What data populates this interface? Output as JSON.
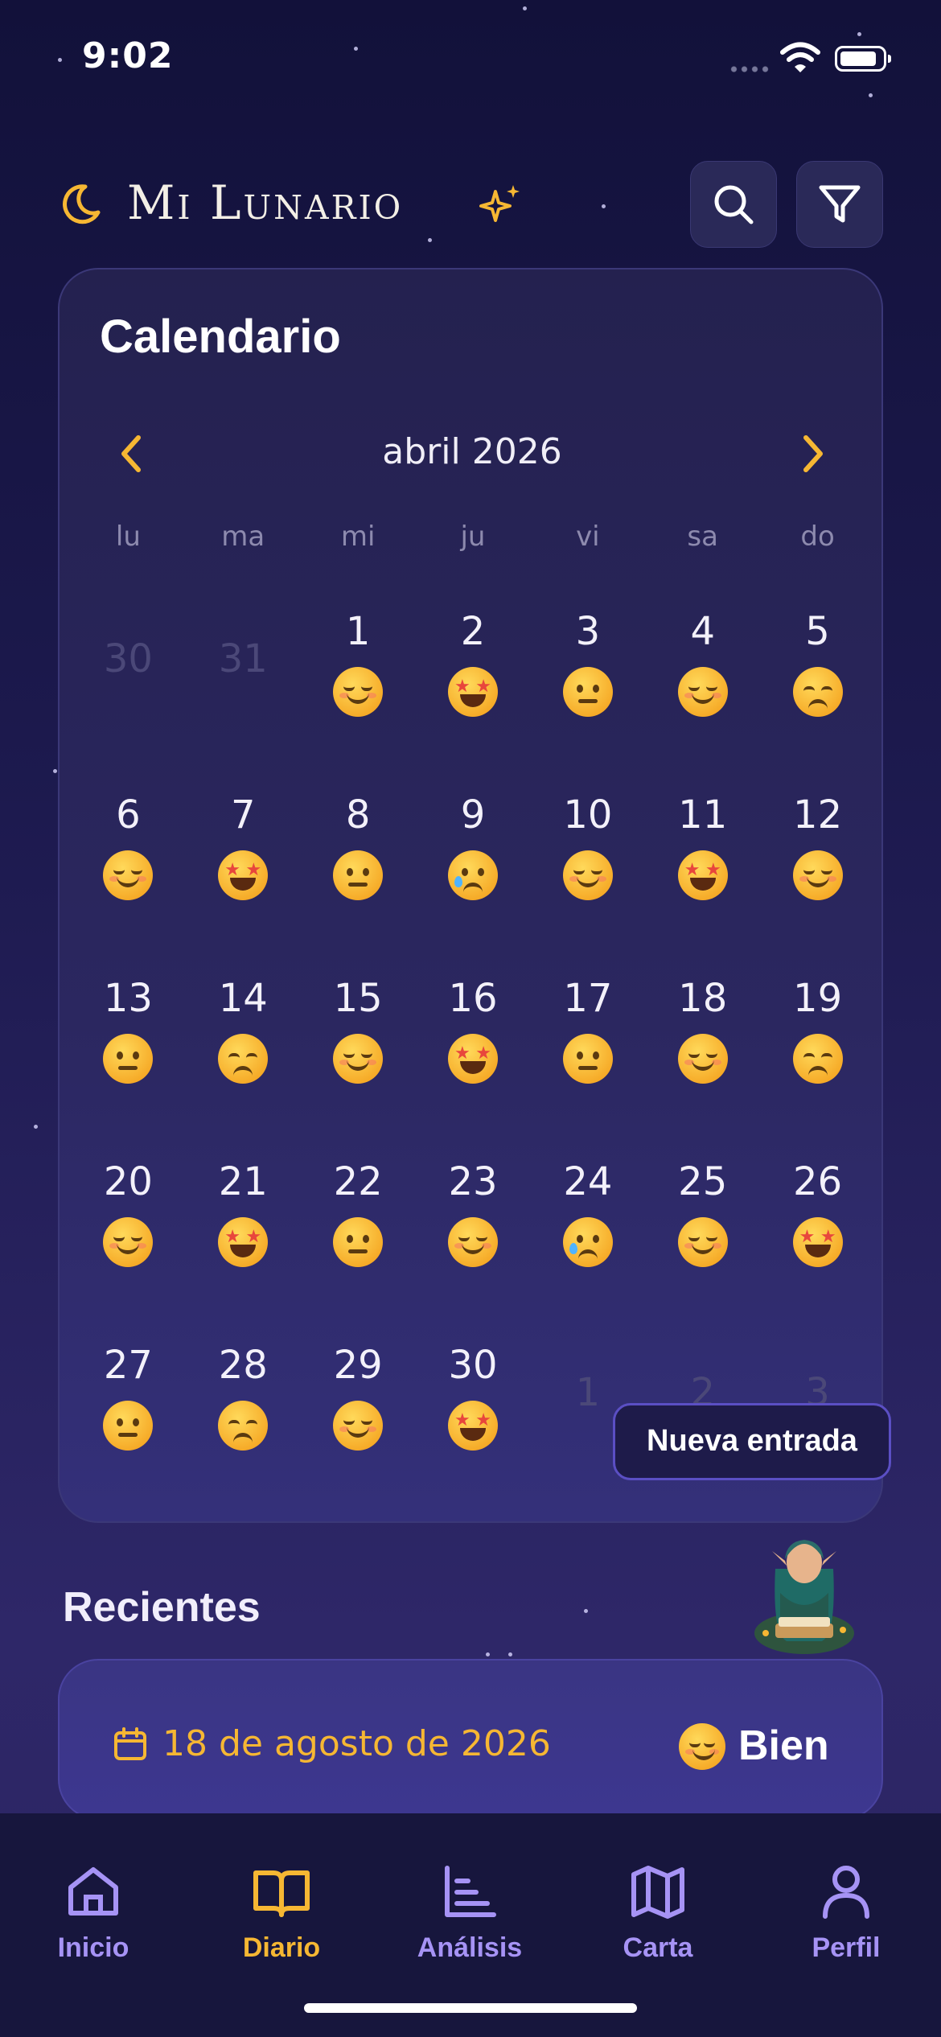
{
  "status_bar": {
    "time": "9:02"
  },
  "header": {
    "title": "Mi Lunario"
  },
  "calendar": {
    "title": "Calendario",
    "month_label": "abril 2026",
    "weekdays": [
      "lu",
      "ma",
      "mi",
      "ju",
      "vi",
      "sa",
      "do"
    ],
    "days": [
      {
        "n": "30",
        "other": true,
        "mood": ""
      },
      {
        "n": "31",
        "other": true,
        "mood": ""
      },
      {
        "n": "1",
        "mood": "happy"
      },
      {
        "n": "2",
        "mood": "starstruck"
      },
      {
        "n": "3",
        "mood": "neutral"
      },
      {
        "n": "4",
        "mood": "happy"
      },
      {
        "n": "5",
        "mood": "pensive"
      },
      {
        "n": "6",
        "mood": "happy"
      },
      {
        "n": "7",
        "mood": "starstruck"
      },
      {
        "n": "8",
        "mood": "neutral"
      },
      {
        "n": "9",
        "mood": "crying"
      },
      {
        "n": "10",
        "mood": "happy"
      },
      {
        "n": "11",
        "mood": "starstruck"
      },
      {
        "n": "12",
        "mood": "happy"
      },
      {
        "n": "13",
        "mood": "neutral"
      },
      {
        "n": "14",
        "mood": "pensive"
      },
      {
        "n": "15",
        "mood": "happy"
      },
      {
        "n": "16",
        "mood": "starstruck"
      },
      {
        "n": "17",
        "mood": "neutral"
      },
      {
        "n": "18",
        "mood": "happy"
      },
      {
        "n": "19",
        "mood": "pensive"
      },
      {
        "n": "20",
        "mood": "happy"
      },
      {
        "n": "21",
        "mood": "starstruck"
      },
      {
        "n": "22",
        "mood": "neutral"
      },
      {
        "n": "23",
        "mood": "happy"
      },
      {
        "n": "24",
        "mood": "crying"
      },
      {
        "n": "25",
        "mood": "happy"
      },
      {
        "n": "26",
        "mood": "starstruck"
      },
      {
        "n": "27",
        "mood": "neutral"
      },
      {
        "n": "28",
        "mood": "pensive"
      },
      {
        "n": "29",
        "mood": "happy"
      },
      {
        "n": "30",
        "mood": "starstruck"
      },
      {
        "n": "1",
        "other": true,
        "mood": ""
      },
      {
        "n": "2",
        "other": true,
        "mood": ""
      },
      {
        "n": "3",
        "other": true,
        "mood": ""
      }
    ]
  },
  "new_entry": {
    "label": "Nueva entrada"
  },
  "recent": {
    "title": "Recientes",
    "entries": [
      {
        "date": "18 de agosto de 2026",
        "mood_label": "Bien",
        "mood": "happy"
      }
    ]
  },
  "tabs": [
    {
      "label": "Inicio",
      "icon": "home-icon",
      "active": false
    },
    {
      "label": "Diario",
      "icon": "book-icon",
      "active": true
    },
    {
      "label": "Análisis",
      "icon": "chart-icon",
      "active": false
    },
    {
      "label": "Carta",
      "icon": "map-icon",
      "active": false
    },
    {
      "label": "Perfil",
      "icon": "user-icon",
      "active": false
    }
  ],
  "colors": {
    "accent": "#f6b733",
    "tab_inactive": "#a693f5",
    "background": "#1d1a4f"
  }
}
